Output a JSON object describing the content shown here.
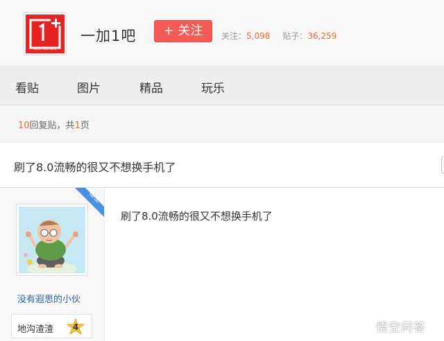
{
  "header": {
    "logo": {
      "icon": "oneplus-logo-icon",
      "subtext": "OnePlus one",
      "color": "#e62222"
    },
    "forum_name": "一加1吧",
    "follow_label": "+ 关注",
    "stats": {
      "follow_label": "关注：",
      "follow_value": "5,098",
      "posts_label": "贴子：",
      "posts_value": "36,259"
    }
  },
  "nav": {
    "items": [
      {
        "label": "看贴"
      },
      {
        "label": "图片"
      },
      {
        "label": "精品"
      },
      {
        "label": "玩乐"
      }
    ]
  },
  "thread_meta": {
    "reply_count": "10",
    "reply_text": "回复贴，共",
    "page_count": "1",
    "page_text": "页"
  },
  "thread": {
    "title": "刷了8.0流畅的很又不想换手机了"
  },
  "post": {
    "ribbon": "楼主",
    "author": {
      "avatar": "cartoon-avatar",
      "name": "没有遐思的小伙",
      "rank": "地沟渣渣",
      "level": "4"
    },
    "content": "刷了8.0流畅的很又不想换手机了"
  },
  "watermark": {
    "icon": "wukong-logo-icon",
    "text": "悟空问答"
  },
  "colors": {
    "accent_red": "#f55a55",
    "number_orange": "#f2662c",
    "link_blue": "#3163a6",
    "ribbon_blue": "#4a90e2"
  }
}
